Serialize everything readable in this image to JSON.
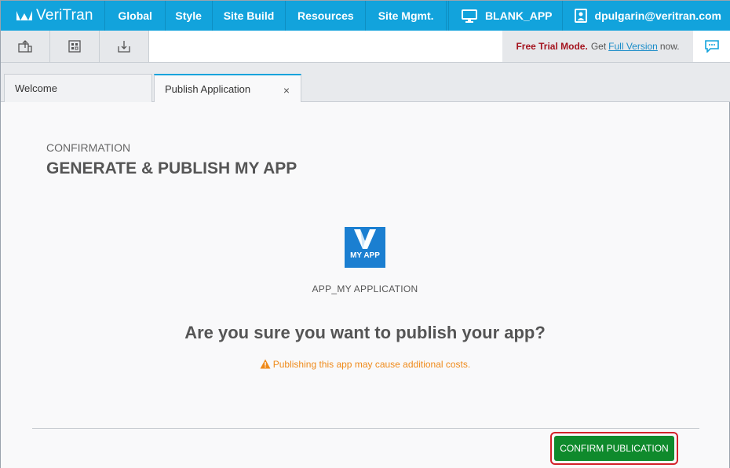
{
  "brand": {
    "name": "VeriTran",
    "color": "#12a3dc"
  },
  "nav": {
    "items": [
      "Global",
      "Style",
      "Site Build",
      "Resources",
      "Site Mgmt."
    ],
    "app_name": "BLANK_APP",
    "user": "dpulgarin@veritran.com"
  },
  "toolbar": {
    "icons": [
      "export-icon",
      "grid-icon",
      "download-icon"
    ],
    "trial_bold": "Free Trial Mode.",
    "trial_get": "Get",
    "trial_link": "Full Version",
    "trial_now": "now."
  },
  "tabs": [
    {
      "label": "Welcome",
      "active": false
    },
    {
      "label": "Publish Application",
      "active": true,
      "close": "×"
    }
  ],
  "main": {
    "eyebrow": "CONFIRMATION",
    "title": "GENERATE & PUBLISH MY APP",
    "app_icon_label": "MY APP",
    "app_name": "APP_MY APPLICATION",
    "question": "Are you sure you want to publish your app?",
    "warning": "Publishing this app may cause additional costs.",
    "confirm_button": "CONFIRM PUBLICATION"
  },
  "colors": {
    "confirm": "#0f8a2c",
    "highlight": "#d3222a",
    "warning": "#ef8a1a",
    "trial": "#a4141f"
  }
}
